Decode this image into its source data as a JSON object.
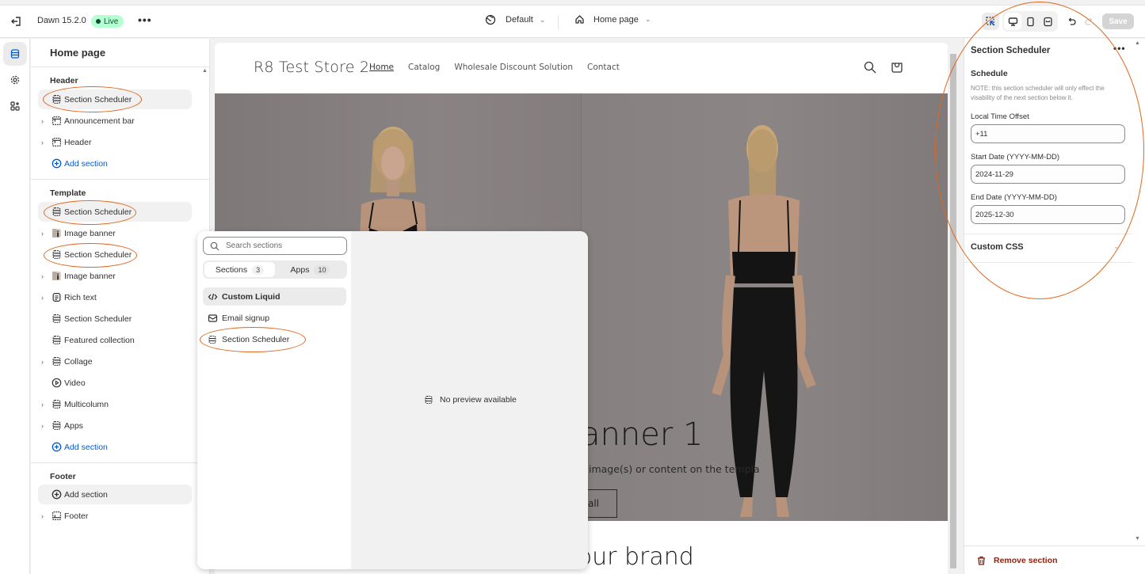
{
  "topbar": {
    "theme_name": "Dawn 15.2.0",
    "live_badge": "Live",
    "more_label": "•••",
    "theme_selector": "Default",
    "page_selector": "Home page",
    "save_label": "Save",
    "icons": [
      "exit-icon",
      "globe-icon",
      "home-icon",
      "inspector-icon",
      "desktop-icon",
      "mobile-icon",
      "full-width-icon",
      "undo-icon",
      "redo-icon"
    ]
  },
  "rail": {
    "items": [
      {
        "icon": "sections-icon",
        "active": true
      },
      {
        "icon": "settings-gear-icon",
        "active": false
      },
      {
        "icon": "apps-icon",
        "active": false
      }
    ]
  },
  "sidebar": {
    "title": "Home page",
    "groups": [
      {
        "label": "Header",
        "items": [
          {
            "label": "Section Scheduler",
            "icon": "section-icon",
            "expandable": false,
            "selected": true,
            "annotated": true
          },
          {
            "label": "Announcement bar",
            "icon": "layout-icon",
            "expandable": true
          },
          {
            "label": "Header",
            "icon": "layout-icon",
            "expandable": true
          },
          {
            "label": "Add section",
            "icon": "plus-circle-icon",
            "add": true
          }
        ]
      },
      {
        "label": "Template",
        "items": [
          {
            "label": "Section Scheduler",
            "icon": "section-icon",
            "expandable": false,
            "selected": true,
            "annotated": true
          },
          {
            "label": "Image banner",
            "icon": "image-thumbnail-icon",
            "expandable": true
          },
          {
            "label": "Section Scheduler",
            "icon": "section-icon",
            "expandable": false,
            "annotated": true
          },
          {
            "label": "Image banner",
            "icon": "image-thumbnail-icon",
            "expandable": true
          },
          {
            "label": "Rich text",
            "icon": "text-icon",
            "expandable": true
          },
          {
            "label": "Section Scheduler",
            "icon": "section-icon",
            "expandable": false
          },
          {
            "label": "Featured collection",
            "icon": "section-icon",
            "expandable": false
          },
          {
            "label": "Collage",
            "icon": "section-icon",
            "expandable": true
          },
          {
            "label": "Video",
            "icon": "play-icon",
            "expandable": false
          },
          {
            "label": "Multicolumn",
            "icon": "section-icon",
            "expandable": true
          },
          {
            "label": "Apps",
            "icon": "section-icon",
            "expandable": true
          },
          {
            "label": "Add section",
            "icon": "plus-circle-icon",
            "add": true
          }
        ]
      },
      {
        "label": "Footer",
        "items": [
          {
            "label": "Add section",
            "icon": "plus-circle-icon",
            "add": true,
            "selected": true
          },
          {
            "label": "Footer",
            "icon": "footer-icon",
            "expandable": true
          }
        ]
      }
    ]
  },
  "preview": {
    "store_name": "R8 Test Store 2",
    "nav": [
      "Home",
      "Catalog",
      "Wholesale Discount Solution",
      "Contact"
    ],
    "nav_active": "Home",
    "banner_heading": "anner 1",
    "banner_sub": "image(s) or content on the templa",
    "banner_button": "all",
    "below_heading": "your brand"
  },
  "picker": {
    "search_placeholder": "Search sections",
    "tabs": [
      {
        "label": "Sections",
        "count": "3",
        "active": true
      },
      {
        "label": "Apps",
        "count": "10",
        "active": false
      }
    ],
    "items": [
      {
        "label": "Custom Liquid",
        "icon": "code-icon",
        "highlighted": true
      },
      {
        "label": "Email signup",
        "icon": "email-icon"
      },
      {
        "label": "Section Scheduler",
        "icon": "section-icon",
        "annotated": true
      }
    ],
    "no_preview": "No preview available"
  },
  "settings": {
    "title": "Section Scheduler",
    "more_label": "•••",
    "heading": "Schedule",
    "note": "NOTE: this section scheduler will only effect the visability of the next section below it.",
    "fields": [
      {
        "label": "Local Time Offset",
        "value": "+11"
      },
      {
        "label": "Start Date (YYYY-MM-DD)",
        "value": "2024-11-29"
      },
      {
        "label": "End Date (YYYY-MM-DD)",
        "value": "2025-12-30"
      }
    ],
    "custom_css": "Custom CSS",
    "remove_label": "Remove section"
  },
  "colors": {
    "accent_link": "#005bd3",
    "live_badge_bg": "#b4fed2",
    "live_badge_text": "#0c5132",
    "annotation": "#e0661e",
    "danger": "#8e1f0b",
    "save_disabled": "#d4d4d4"
  }
}
